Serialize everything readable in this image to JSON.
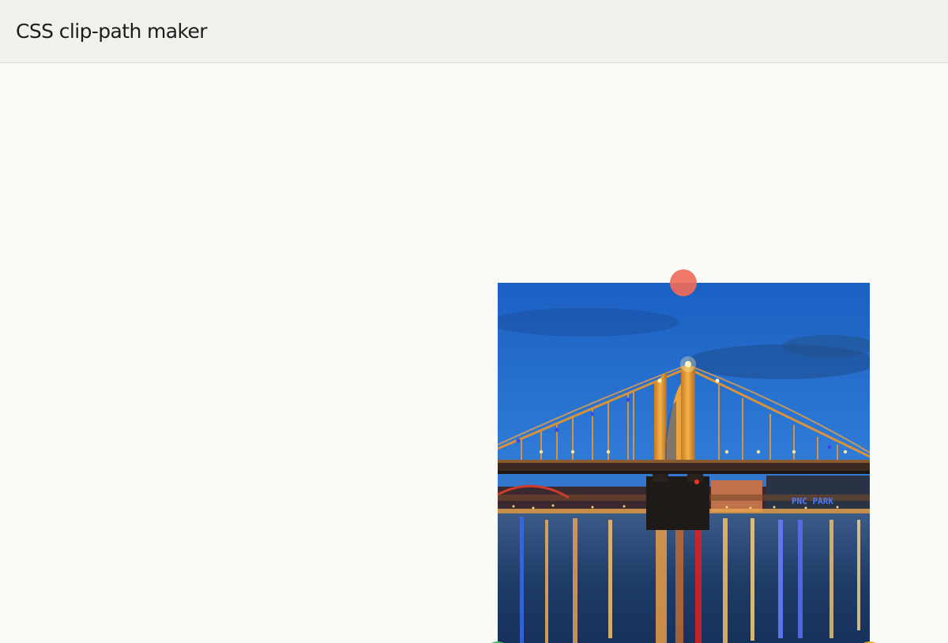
{
  "header": {
    "title": "CSS clip-path maker"
  },
  "editor": {
    "image": {
      "subject": "bridge-night-photo",
      "sign_text": "PNC PARK"
    },
    "handles": [
      {
        "name": "handle-top",
        "color": "#ee6c5c"
      },
      {
        "name": "handle-bottom-left",
        "color": "#3cb45a"
      },
      {
        "name": "handle-bottom-right",
        "color": "#e4b228"
      }
    ]
  },
  "colors": {
    "page_background": "#fafaf6",
    "header_background": "#f0f0ec",
    "header_border": "#dddcd6",
    "title_text": "#1c1c1c"
  }
}
